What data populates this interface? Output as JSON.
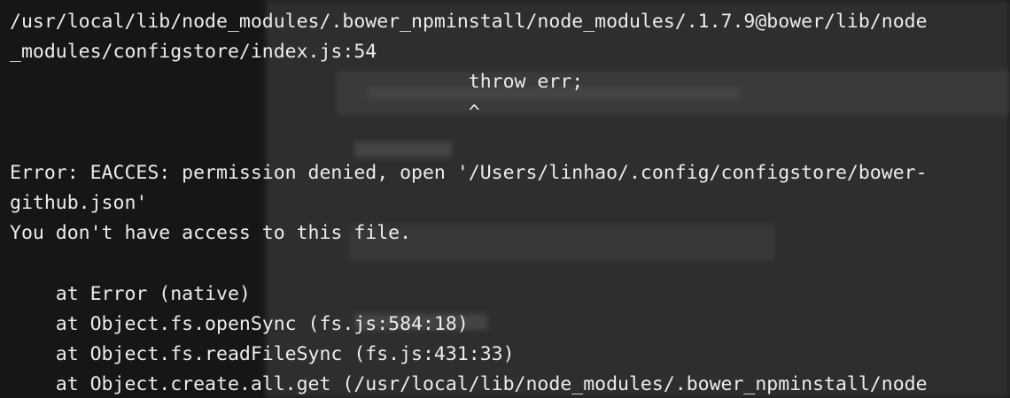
{
  "terminal": {
    "lines": [
      "/usr/local/lib/node_modules/.bower_npminstall/node_modules/.1.7.9@bower/lib/node",
      "_modules/configstore/index.js:54",
      "                                        throw err;",
      "                                        ^",
      "",
      "Error: EACCES: permission denied, open '/Users/linhao/.config/configstore/bower-",
      "github.json'",
      "You don't have access to this file.",
      "",
      "    at Error (native)",
      "    at Object.fs.openSync (fs.js:584:18)",
      "    at Object.fs.readFileSync (fs.js:431:33)",
      "    at Object.create.all.get (/usr/local/lib/node_modules/.bower_npminstall/node"
    ],
    "colors": {
      "background": "#161616",
      "text": "#ececec"
    }
  }
}
